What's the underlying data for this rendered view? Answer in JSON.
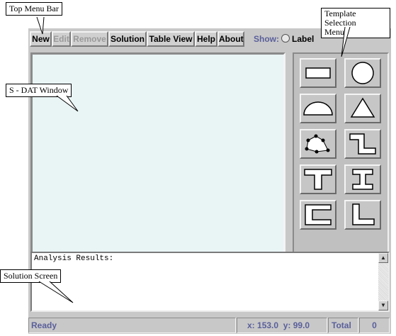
{
  "menu": {
    "items": [
      {
        "label": "New",
        "enabled": true
      },
      {
        "label": "Edit",
        "enabled": false
      },
      {
        "label": "Remove",
        "enabled": false
      },
      {
        "label": "Solution",
        "enabled": true
      },
      {
        "label": "Table View",
        "enabled": true
      },
      {
        "label": "Help",
        "enabled": true
      },
      {
        "label": "About",
        "enabled": true
      }
    ],
    "show_label": "Show:",
    "label_option": "Label",
    "label_checked": false
  },
  "templates": [
    {
      "icon": "rectangle-icon"
    },
    {
      "icon": "circle-icon"
    },
    {
      "icon": "semicircle-icon"
    },
    {
      "icon": "triangle-icon"
    },
    {
      "icon": "polygon-icon"
    },
    {
      "icon": "z-section-icon"
    },
    {
      "icon": "t-section-icon"
    },
    {
      "icon": "i-section-icon"
    },
    {
      "icon": "c-section-icon"
    },
    {
      "icon": "l-section-icon"
    }
  ],
  "results": {
    "text": "Analysis Results:"
  },
  "status": {
    "text": "Ready",
    "x_label": "x:",
    "x_value": "153.0",
    "y_label": "y:",
    "y_value": "99.0",
    "total_label": "Total",
    "total_value": "0"
  },
  "callouts": {
    "menu_bar": "Top Menu Bar",
    "template_menu_line1": "Template Selection",
    "template_menu_line2": "Menu",
    "sdat_window": "S - DAT Window",
    "solution_screen": "Solution Screen"
  },
  "colors": {
    "canvas": "#e9f4f5",
    "panel": "#c8c8c8",
    "status_text": "#5a5f9a"
  }
}
